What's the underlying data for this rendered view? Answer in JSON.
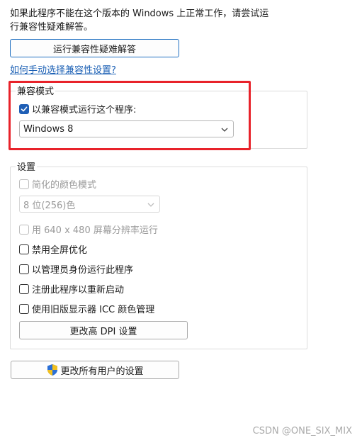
{
  "intro": {
    "line1": "如果此程序不能在这个版本的 Windows 上正常工作，请尝试运",
    "line2": "行兼容性疑难解答。"
  },
  "run_troubleshooter_button": "运行兼容性疑难解答",
  "manual_link": "如何手动选择兼容性设置?",
  "compat_mode": {
    "group_label": "兼容模式",
    "checkbox_label": "以兼容模式运行这个程序:",
    "checkbox_checked": true,
    "os_selected": "Windows 8"
  },
  "settings": {
    "group_label": "设置",
    "reduced_color_label": "简化的颜色模式",
    "color_depth_selected": "8 位(256)色",
    "res_640_label": "用 640 x 480 屏幕分辨率运行",
    "disable_fullscreen_label": "禁用全屏优化",
    "run_as_admin_label": "以管理员身份运行此程序",
    "register_restart_label": "注册此程序以重新启动",
    "legacy_icc_label": "使用旧版显示器 ICC 颜色管理",
    "change_dpi_button": "更改高 DPI 设置"
  },
  "change_all_users_button": "更改所有用户的设置",
  "watermark": "CSDN @ONE_SIX_MIX",
  "colors": {
    "accent": "#1f5fb6",
    "highlight_box": "#e8222a",
    "link": "#1a5fb4"
  }
}
